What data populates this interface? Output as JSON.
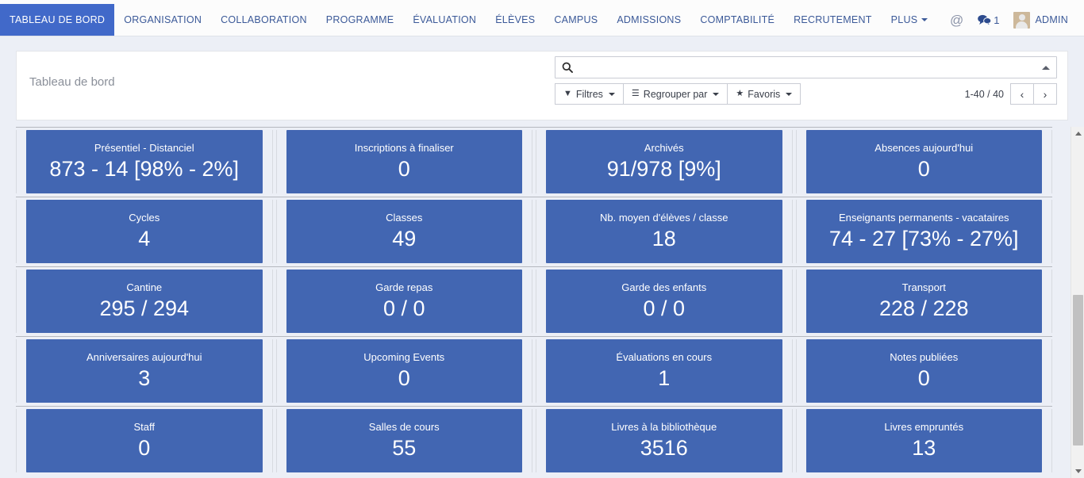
{
  "navbar": {
    "items": [
      {
        "label": "TABLEAU DE BORD",
        "active": true,
        "caret": false
      },
      {
        "label": "ORGANISATION",
        "active": false,
        "caret": false
      },
      {
        "label": "COLLABORATION",
        "active": false,
        "caret": false
      },
      {
        "label": "PROGRAMME",
        "active": false,
        "caret": false
      },
      {
        "label": "ÉVALUATION",
        "active": false,
        "caret": false
      },
      {
        "label": "ÉLÈVES",
        "active": false,
        "caret": false
      },
      {
        "label": "CAMPUS",
        "active": false,
        "caret": false
      },
      {
        "label": "ADMISSIONS",
        "active": false,
        "caret": false
      },
      {
        "label": "COMPTABILITÉ",
        "active": false,
        "caret": false
      },
      {
        "label": "RECRUTEMENT",
        "active": false,
        "caret": false
      },
      {
        "label": "PLUS",
        "active": false,
        "caret": true
      }
    ],
    "mentions_icon": "at-icon",
    "messages_icon": "chat-bubble-icon",
    "messages_count": "1",
    "user_label": "ADMIN",
    "avatar_icon": "user-avatar",
    "accent_color": "#4169c9",
    "link_color": "#3b5998"
  },
  "control_panel": {
    "title": "Tableau de bord",
    "search": {
      "icon": "search-icon",
      "value": "",
      "placeholder": "",
      "toggle_icon": "chevron-up-icon"
    },
    "buttons": [
      {
        "icon": "filter-icon",
        "glyph": "▼",
        "label": "Filtres",
        "caret": true
      },
      {
        "icon": "group-by-icon",
        "glyph": "☰",
        "label": "Regrouper par",
        "caret": true
      },
      {
        "icon": "star-icon",
        "glyph": "★",
        "label": "Favoris",
        "caret": true
      }
    ],
    "pager": {
      "count": "1-40 / 40",
      "prev_icon": "chevron-left-icon",
      "prev_glyph": "‹",
      "next_icon": "chevron-right-icon",
      "next_glyph": "›"
    }
  },
  "tiles": {
    "accent_color": "#4266b2",
    "rows": [
      [
        {
          "label": "Présentiel - Distanciel",
          "value": "873 - 14 [98% - 2%]"
        },
        {
          "label": "Inscriptions à finaliser",
          "value": "0"
        },
        {
          "label": "Archivés",
          "value": "91/978 [9%]"
        },
        {
          "label": "Absences aujourd'hui",
          "value": "0"
        }
      ],
      [
        {
          "label": "Cycles",
          "value": "4"
        },
        {
          "label": "Classes",
          "value": "49"
        },
        {
          "label": "Nb. moyen d'élèves / classe",
          "value": "18"
        },
        {
          "label": "Enseignants permanents - vacataires",
          "value": "74 - 27 [73% - 27%]"
        }
      ],
      [
        {
          "label": "Cantine",
          "value": "295 / 294"
        },
        {
          "label": "Garde repas",
          "value": "0 / 0"
        },
        {
          "label": "Garde des enfants",
          "value": "0 / 0"
        },
        {
          "label": "Transport",
          "value": "228 / 228"
        }
      ],
      [
        {
          "label": "Anniversaires aujourd'hui",
          "value": "3"
        },
        {
          "label": "Upcoming Events",
          "value": "0"
        },
        {
          "label": "Évaluations en cours",
          "value": "1"
        },
        {
          "label": "Notes publiées",
          "value": "0"
        }
      ],
      [
        {
          "label": "Staff",
          "value": "0"
        },
        {
          "label": "Salles de cours",
          "value": "55"
        },
        {
          "label": "Livres à la bibliothèque",
          "value": "3516"
        },
        {
          "label": "Livres empruntés",
          "value": "13"
        }
      ]
    ]
  },
  "scrollbar": {
    "up_icon": "scroll-up-arrow-icon",
    "down_icon": "scroll-down-arrow-icon",
    "thumb": "scroll-thumb"
  }
}
